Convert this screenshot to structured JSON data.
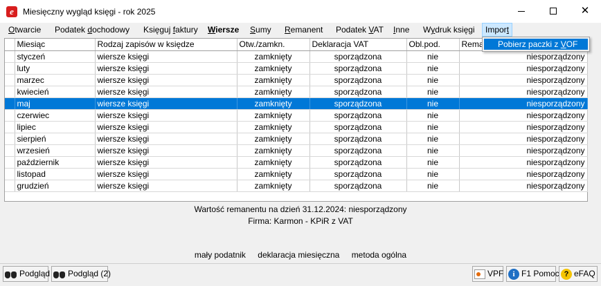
{
  "window": {
    "title": "Miesięczny wygląd księgi - rok 2025",
    "app_icon_letter": "e"
  },
  "menu": {
    "items": [
      {
        "pre": "",
        "mn": "O",
        "post": "twarcie"
      },
      {
        "pre": "Podatek ",
        "mn": "d",
        "post": "ochodowy"
      },
      {
        "pre": "Księguj ",
        "mn": "f",
        "post": "aktury"
      },
      {
        "pre": "",
        "mn": "W",
        "post": "iersze"
      },
      {
        "pre": "",
        "mn": "S",
        "post": "umy"
      },
      {
        "pre": "",
        "mn": "R",
        "post": "emanent"
      },
      {
        "pre": "Podatek ",
        "mn": "V",
        "post": "AT"
      },
      {
        "pre": "",
        "mn": "I",
        "post": "nne"
      },
      {
        "pre": "W",
        "mn": "y",
        "post": "druk księgi"
      },
      {
        "pre": "Impor",
        "mn": "t",
        "post": ""
      }
    ],
    "dropdown": {
      "pre": "Pobierz paczki z ",
      "mn": "V",
      "post": "OF"
    }
  },
  "table": {
    "headers": [
      "Miesiąc",
      "Rodzaj zapisów w księdze",
      "Otw./zamkn.",
      "Deklaracja VAT",
      "Obl.pod.",
      "Rema"
    ],
    "rows": [
      [
        "styczeń",
        "wiersze księgi",
        "zamknięty",
        "sporządzona",
        "nie",
        "niesporządzony"
      ],
      [
        "luty",
        "wiersze księgi",
        "zamknięty",
        "sporządzona",
        "nie",
        "niesporządzony"
      ],
      [
        "marzec",
        "wiersze księgi",
        "zamknięty",
        "sporządzona",
        "nie",
        "niesporządzony"
      ],
      [
        "kwiecień",
        "wiersze księgi",
        "zamknięty",
        "sporządzona",
        "nie",
        "niesporządzony"
      ],
      [
        "maj",
        "wiersze księgi",
        "zamknięty",
        "sporządzona",
        "nie",
        "niesporządzony"
      ],
      [
        "czerwiec",
        "wiersze księgi",
        "zamknięty",
        "sporządzona",
        "nie",
        "niesporządzony"
      ],
      [
        "lipiec",
        "wiersze księgi",
        "zamknięty",
        "sporządzona",
        "nie",
        "niesporządzony"
      ],
      [
        "sierpień",
        "wiersze księgi",
        "zamknięty",
        "sporządzona",
        "nie",
        "niesporządzony"
      ],
      [
        "wrzesień",
        "wiersze księgi",
        "zamknięty",
        "sporządzona",
        "nie",
        "niesporządzony"
      ],
      [
        "październik",
        "wiersze księgi",
        "zamknięty",
        "sporządzona",
        "nie",
        "niesporządzony"
      ],
      [
        "listopad",
        "wiersze księgi",
        "zamknięty",
        "sporządzona",
        "nie",
        "niesporządzony"
      ],
      [
        "grudzień",
        "wiersze księgi",
        "zamknięty",
        "sporządzona",
        "nie",
        "niesporządzony"
      ]
    ]
  },
  "info": {
    "remanent": "Wartość remanentu na dzień 31.12.2024:  niesporządzony",
    "firma": "Firma: Karmon - KPiR z VAT",
    "taxpayer": "mały podatnik",
    "declaration": "deklaracja miesięczna",
    "method": "metoda ogólna"
  },
  "toolbar": {
    "preview": "Podgląd",
    "preview2": "Podgląd (2)",
    "vpf": "VPF",
    "help": "F1 Pomoc",
    "efaq": "eFAQ",
    "info_glyph": "i",
    "help_glyph": "?"
  }
}
